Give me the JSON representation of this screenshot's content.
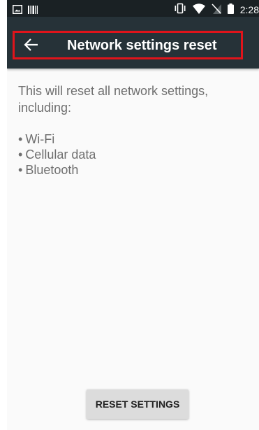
{
  "status_bar": {
    "time": "2:28",
    "left_icons": [
      "image-icon",
      "barcode-icon"
    ],
    "right_icons": [
      "vibrate-icon",
      "wifi-icon",
      "no-sim-icon",
      "battery-icon"
    ]
  },
  "app_bar": {
    "title": "Network settings reset",
    "back_icon": "back-arrow-icon",
    "highlight_color": "#e0141b"
  },
  "content": {
    "intro": "This will reset all network settings, including:",
    "items": [
      {
        "bullet": "•",
        "label": "Wi-Fi"
      },
      {
        "bullet": "•",
        "label": "Cellular data"
      },
      {
        "bullet": "•",
        "label": "Bluetooth"
      }
    ]
  },
  "reset_button": {
    "label": "RESET SETTINGS"
  },
  "colors": {
    "status_bar_bg": "#1a2124",
    "app_bar_bg": "#263238",
    "screen_bg": "#fafafa",
    "body_text": "#6f6f6f",
    "button_bg": "#dcdcdc"
  }
}
